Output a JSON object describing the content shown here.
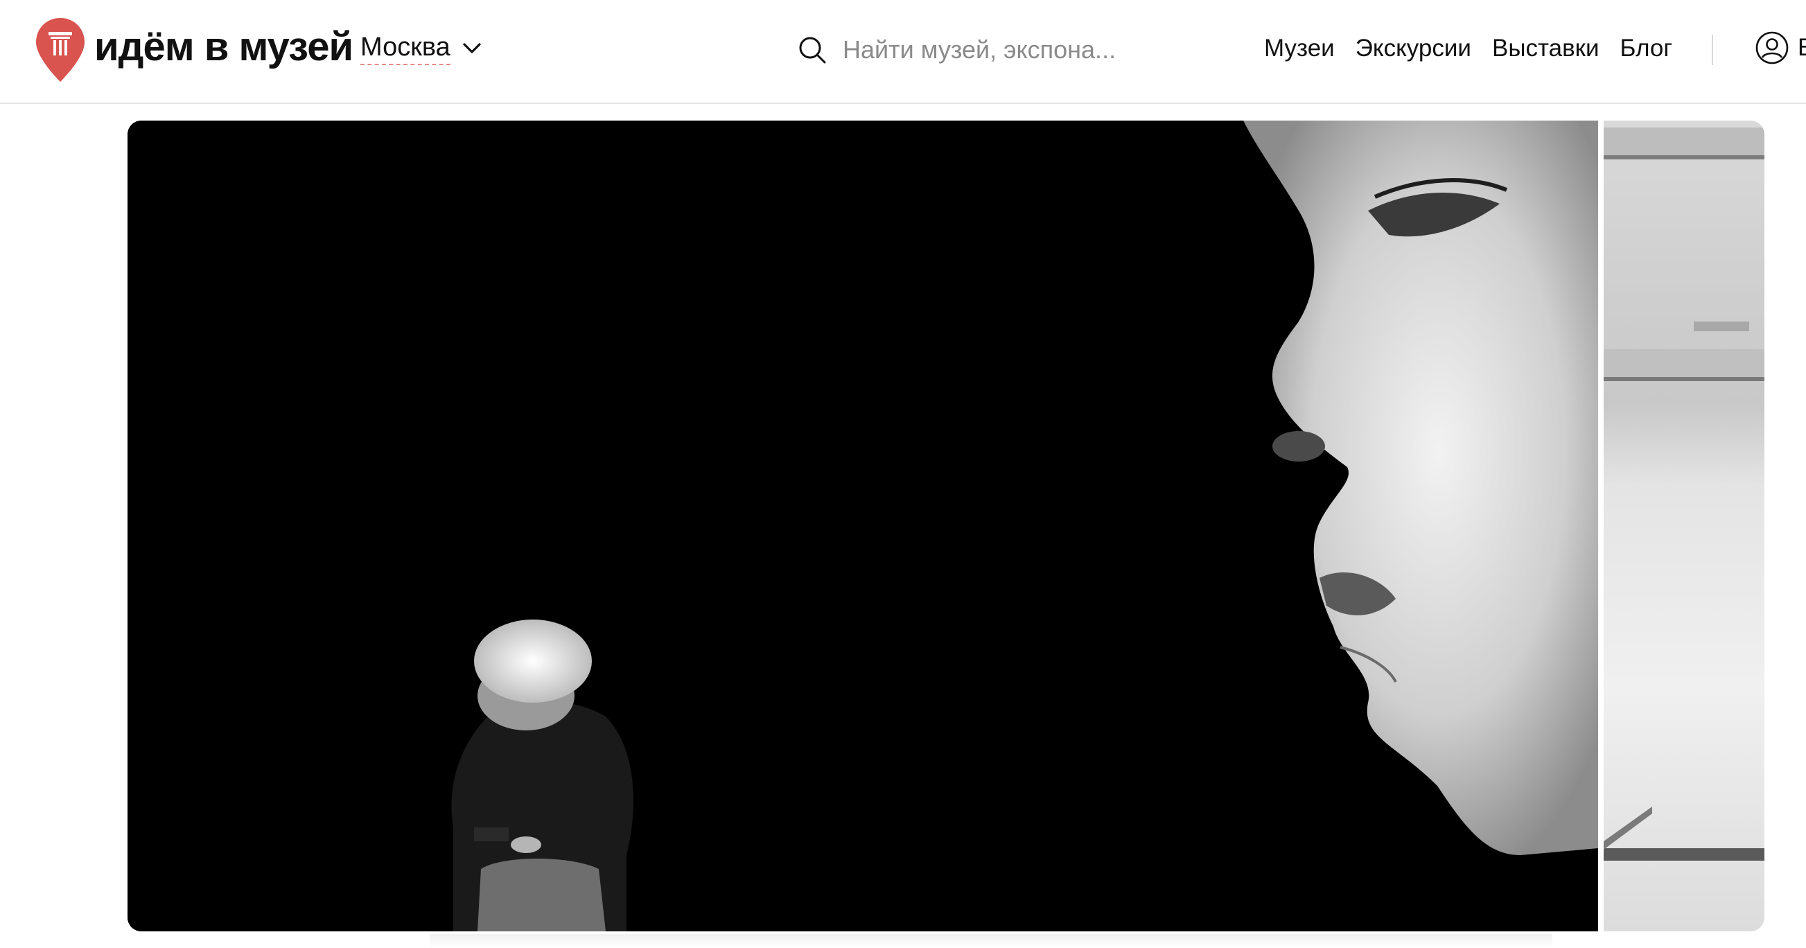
{
  "header": {
    "logo_text": "идём в музей",
    "city": "Москва",
    "search_placeholder": "Найти музей, экспона...",
    "nav": [
      "Музеи",
      "Экскурсии",
      "Выставки",
      "Блог"
    ],
    "user_label": "В"
  },
  "icons": {
    "logo": "map-pin-column-icon",
    "city_toggle": "chevron-down-icon",
    "search": "search-icon",
    "user": "user-avatar-icon"
  },
  "colors": {
    "brand": "#d9534f",
    "city_underline": "#e58a86",
    "text": "#111111",
    "placeholder": "#8a8a8a"
  },
  "carousel": {
    "main_slide": "black-and-white-photo-woman-beside-mural-face",
    "next_slide": "grey-interior-photo-partial"
  }
}
